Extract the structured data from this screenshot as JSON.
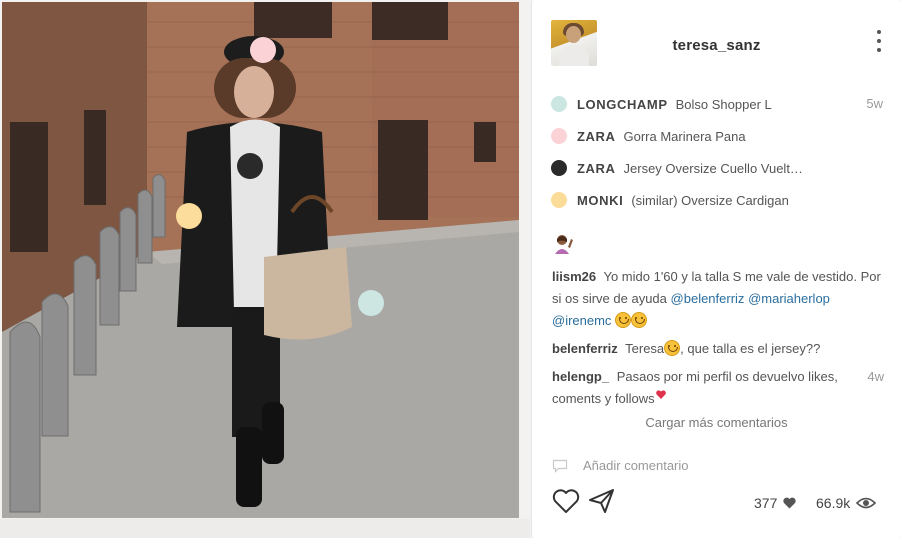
{
  "post": {
    "username": "teresa_sanz",
    "menu_icon": "more-vertical-icon",
    "tag_colors": [
      "#fbd3d6",
      "#2a2a2a",
      "#fddd9c",
      "#cde6e2"
    ]
  },
  "products": [
    {
      "color": "#cce6e1",
      "brand": "LONGCHAMP",
      "name": "Bolso Shopper L",
      "ago": "5w"
    },
    {
      "color": "#fbd3d6",
      "brand": "ZARA",
      "name": "Gorra Marinera Pana",
      "ago": ""
    },
    {
      "color": "#2b2b2b",
      "brand": "ZARA",
      "name": "Jersey Oversize Cuello Vuelt…",
      "ago": ""
    },
    {
      "color": "#fbdc98",
      "brand": "MONKI",
      "name": "(similar) Oversize Cardigan",
      "ago": ""
    }
  ],
  "caption": {
    "emoji": "woman-raising-hand-emoji"
  },
  "comments": [
    {
      "user": "liism26",
      "text": "Yo mido 1'60 y la talla S me vale de vestido. Por si os sirve de ayuda",
      "mention1": "@belenferriz",
      "mention2": "@mariaherlop",
      "mention3": "@irenemc",
      "ago": ""
    },
    {
      "user": "belenferriz",
      "text_before": "Teresa",
      "text_after": ", que talla es el jersey??",
      "ago": ""
    },
    {
      "user": "helengp_",
      "text": "Pasaos por mi perfil os devuelvo likes, coments y follows",
      "ago": "4w"
    }
  ],
  "load_more": "Cargar más comentarios",
  "add_comment": {
    "placeholder": "Añadir comentario",
    "icon": "comment-bubble-icon"
  },
  "actions": {
    "like_icon": "heart-outline-icon",
    "share_icon": "send-icon",
    "likes": "377",
    "views": "66.9k"
  }
}
